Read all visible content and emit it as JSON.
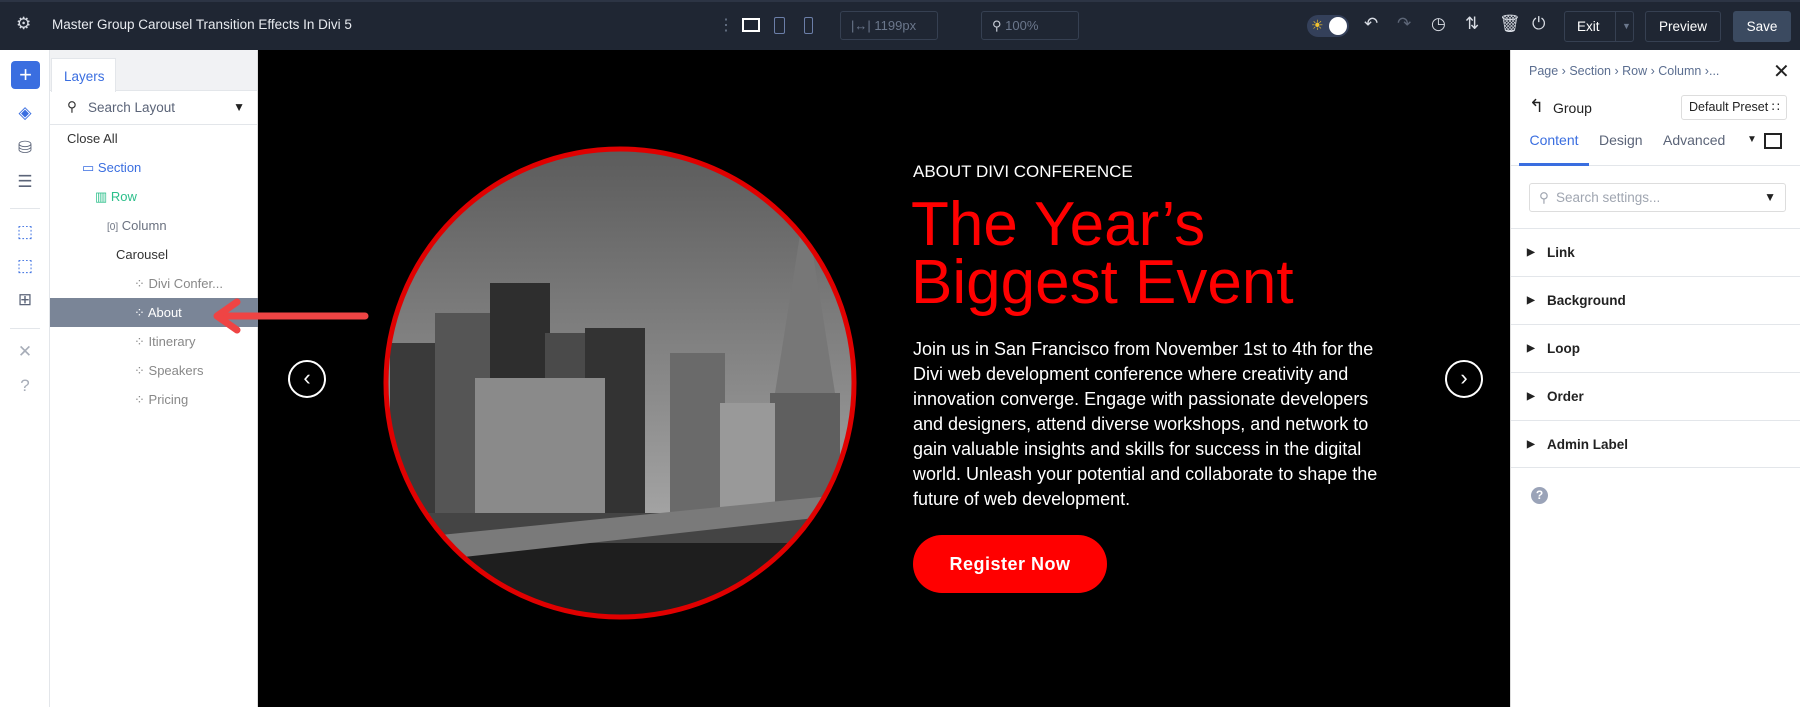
{
  "topbar": {
    "title": "Master Group Carousel Transition Effects In Divi 5",
    "width_value": "1199px",
    "zoom_value": "100%",
    "exit_label": "Exit",
    "preview_label": "Preview",
    "save_label": "Save"
  },
  "layers": {
    "tab": "Layers",
    "search_placeholder": "Search Layout",
    "close_all": "Close All",
    "tree": [
      {
        "label": "Section"
      },
      {
        "label": "Row"
      },
      {
        "label": "Column"
      },
      {
        "label": "Carousel"
      },
      {
        "label": "Divi Confer..."
      },
      {
        "label": "About",
        "selected": true
      },
      {
        "label": "Itinerary"
      },
      {
        "label": "Speakers"
      },
      {
        "label": "Pricing"
      }
    ]
  },
  "slide": {
    "eyebrow": "ABOUT DIVI CONFERENCE",
    "heading_line1": "The Year’s",
    "heading_line2": "Biggest Event",
    "body": "Join us in San Francisco from November 1st to 4th for the Divi web development conference where creativity and innovation converge. Engage with passionate developers and designers, attend diverse workshops, and network to gain valuable insights and skills for success in the digital world. Unleash your potential and collaborate to shape the future of web development.",
    "button": "Register Now",
    "accent": "#ff0000"
  },
  "settings": {
    "breadcrumb": [
      "Page",
      "Section",
      "Row",
      "Column",
      "..."
    ],
    "module": "Group",
    "preset": "Default Preset",
    "tabs": [
      "Content",
      "Design",
      "Advanced"
    ],
    "active_tab": "Content",
    "search_placeholder": "Search settings...",
    "groups": [
      "Link",
      "Background",
      "Loop",
      "Order",
      "Admin Label"
    ]
  },
  "colors": {
    "topbar": "#1f2633",
    "primary": "#3a6ee0",
    "row_green": "#2bbf8a",
    "selected_row": "#7a8597"
  }
}
